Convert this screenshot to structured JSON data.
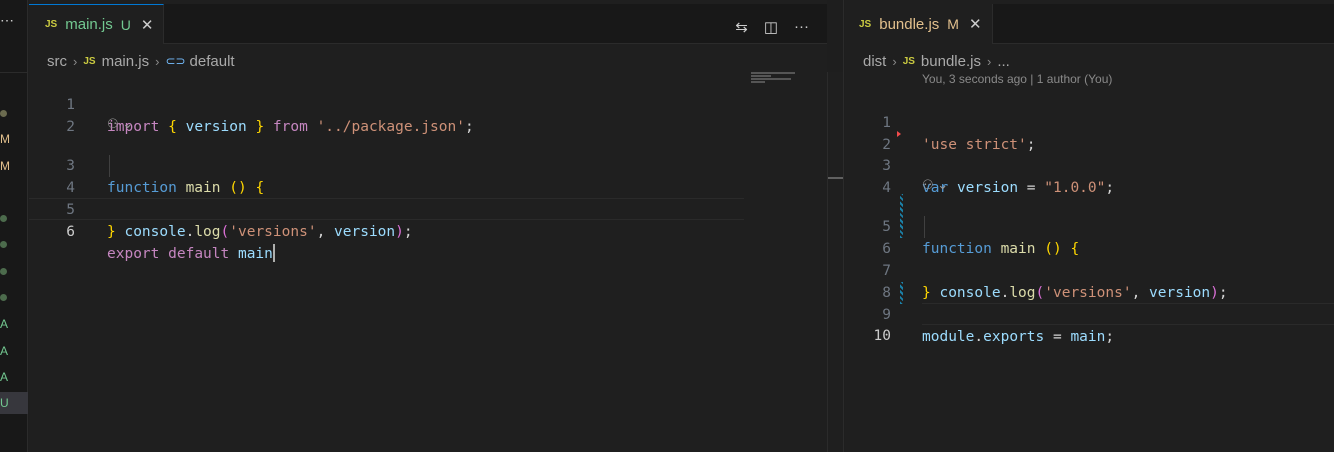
{
  "strip": {
    "items": [
      {
        "kind": "dot",
        "color": "#6b6b4f"
      },
      {
        "kind": "text",
        "text": "M",
        "color": "#e2c08d"
      },
      {
        "kind": "text",
        "text": "M",
        "color": "#e2c08d"
      },
      {
        "kind": "dot",
        "color": "#4c6b4c"
      },
      {
        "kind": "dot",
        "color": "#4c6b4c"
      },
      {
        "kind": "dot",
        "color": "#4c6b4c"
      },
      {
        "kind": "dot",
        "color": "#4c6b4c"
      },
      {
        "kind": "text",
        "text": "A",
        "color": "#73c991"
      },
      {
        "kind": "text",
        "text": "A",
        "color": "#73c991"
      },
      {
        "kind": "text",
        "text": "A",
        "color": "#73c991"
      },
      {
        "kind": "text",
        "text": "U",
        "color": "#73c991"
      }
    ]
  },
  "left": {
    "tab": {
      "label": "main.js",
      "status": "U",
      "close": "✕",
      "lang": "JS"
    },
    "actions": {
      "compare": "⇆",
      "split": "◫",
      "more": "···"
    },
    "breadcrumb": {
      "part1": "src",
      "part2": "main.js",
      "part3": "default",
      "lang": "JS",
      "symbol": "⊂⊃"
    },
    "lines": [
      {
        "n": "1"
      },
      {
        "n": "2"
      },
      {
        "n": "3"
      },
      {
        "n": "4"
      },
      {
        "n": "5"
      },
      {
        "n": "6"
      }
    ],
    "tokens": {
      "l1": [
        "import",
        " ",
        "{",
        " ",
        "version",
        " ",
        "}",
        " ",
        "from",
        " ",
        "'../package.json'",
        ";"
      ],
      "l3": [
        "function",
        " ",
        "main",
        " ",
        "()",
        " ",
        "{"
      ],
      "l4": [
        "  ",
        "console",
        ".",
        "log",
        "(",
        "'versions'",
        ", ",
        "version",
        ")",
        ";"
      ],
      "l5": [
        "}"
      ],
      "l6": [
        "export",
        " ",
        "default",
        " ",
        "main"
      ]
    }
  },
  "right": {
    "tab": {
      "label": "bundle.js",
      "status": "M",
      "close": "✕",
      "lang": "JS"
    },
    "breadcrumb": {
      "part1": "dist",
      "part2": "bundle.js",
      "part3": "...",
      "lang": "JS"
    },
    "blame": "You, 3 seconds ago | 1 author (You)",
    "lines": [
      {
        "n": "1"
      },
      {
        "n": "2"
      },
      {
        "n": "3"
      },
      {
        "n": "4"
      },
      {
        "n": "5"
      },
      {
        "n": "6"
      },
      {
        "n": "7"
      },
      {
        "n": "8"
      },
      {
        "n": "9"
      },
      {
        "n": "10"
      }
    ],
    "tokens": {
      "l1": [
        "'use strict'",
        ";"
      ],
      "l3": [
        "var",
        " ",
        "version",
        " = ",
        "\"1.0.0\"",
        ";"
      ],
      "l5": [
        "function",
        " ",
        "main",
        " ",
        "()",
        " ",
        "{"
      ],
      "l6": [
        "  ",
        "console",
        ".",
        "log",
        "(",
        "'versions'",
        ", ",
        "version",
        ")",
        ";"
      ],
      "l7": [
        "}"
      ],
      "l9": [
        "module",
        ".",
        "exports",
        " = ",
        "main",
        ";"
      ]
    }
  },
  "codelens_icon": "⚇ ⌄",
  "colors": {
    "accent": "#0078d4",
    "keyword": "#c586c0",
    "storage": "#569cd6",
    "variable": "#9cdcfe",
    "function": "#dcdcaa",
    "string": "#ce9178"
  }
}
